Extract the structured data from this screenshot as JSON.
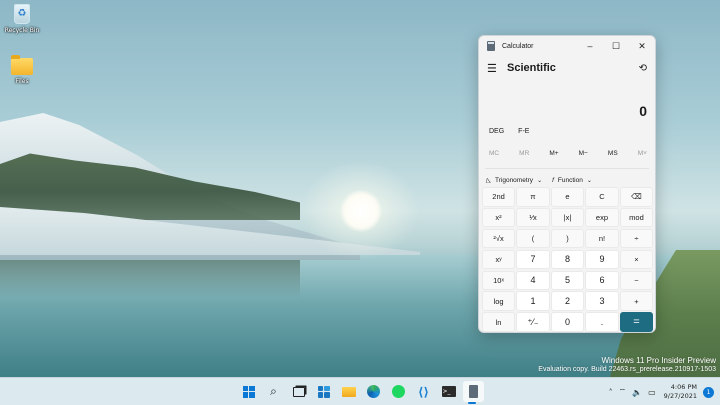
{
  "desktop": {
    "icons": [
      {
        "label": "Recycle Bin"
      },
      {
        "label": "Files"
      }
    ],
    "watermark": {
      "line1": "Windows 11 Pro Insider Preview",
      "line2": "Evaluation copy. Build 22463.rs_prerelease.210917-1503"
    }
  },
  "calculator": {
    "title": "Calculator",
    "window_controls": {
      "minimize": "–",
      "maximize": "☐",
      "close": "✕"
    },
    "menu_icon": "☰",
    "mode": "Scientific",
    "history_icon": "⟲",
    "display": "0",
    "angle_mode": "DEG",
    "fe_label": "F-E",
    "memory": [
      {
        "label": "MC",
        "enabled": false
      },
      {
        "label": "MR",
        "enabled": false
      },
      {
        "label": "M+",
        "enabled": true
      },
      {
        "label": "M−",
        "enabled": true
      },
      {
        "label": "MS",
        "enabled": true
      },
      {
        "label": "M˅",
        "enabled": false
      }
    ],
    "trig_icon": "◺",
    "trig_label": "Trigonometry",
    "func_icon": "f",
    "function_label": "Function",
    "chevron": "⌄",
    "keys": [
      [
        "2nd",
        "π",
        "e",
        "C",
        "⌫"
      ],
      [
        "x²",
        "¹⁄x",
        "|x|",
        "exp",
        "mod"
      ],
      [
        "²√x",
        "(",
        ")",
        "n!",
        "÷"
      ],
      [
        "xʸ",
        "7",
        "8",
        "9",
        "×"
      ],
      [
        "10ˣ",
        "4",
        "5",
        "6",
        "−"
      ],
      [
        "log",
        "1",
        "2",
        "3",
        "+"
      ],
      [
        "ln",
        "⁺⁄₋",
        "0",
        ".",
        "="
      ]
    ]
  },
  "taskbar": {
    "search_icon": "⌕",
    "terminal_icon": ">_",
    "vscode_icon": "⟨⟩",
    "tray": {
      "chevron": "˄",
      "wifi": "⌔",
      "volume": "🔈",
      "battery": "▭",
      "time": "4:06 PM",
      "date": "9/27/2021",
      "notifications": "1"
    }
  }
}
